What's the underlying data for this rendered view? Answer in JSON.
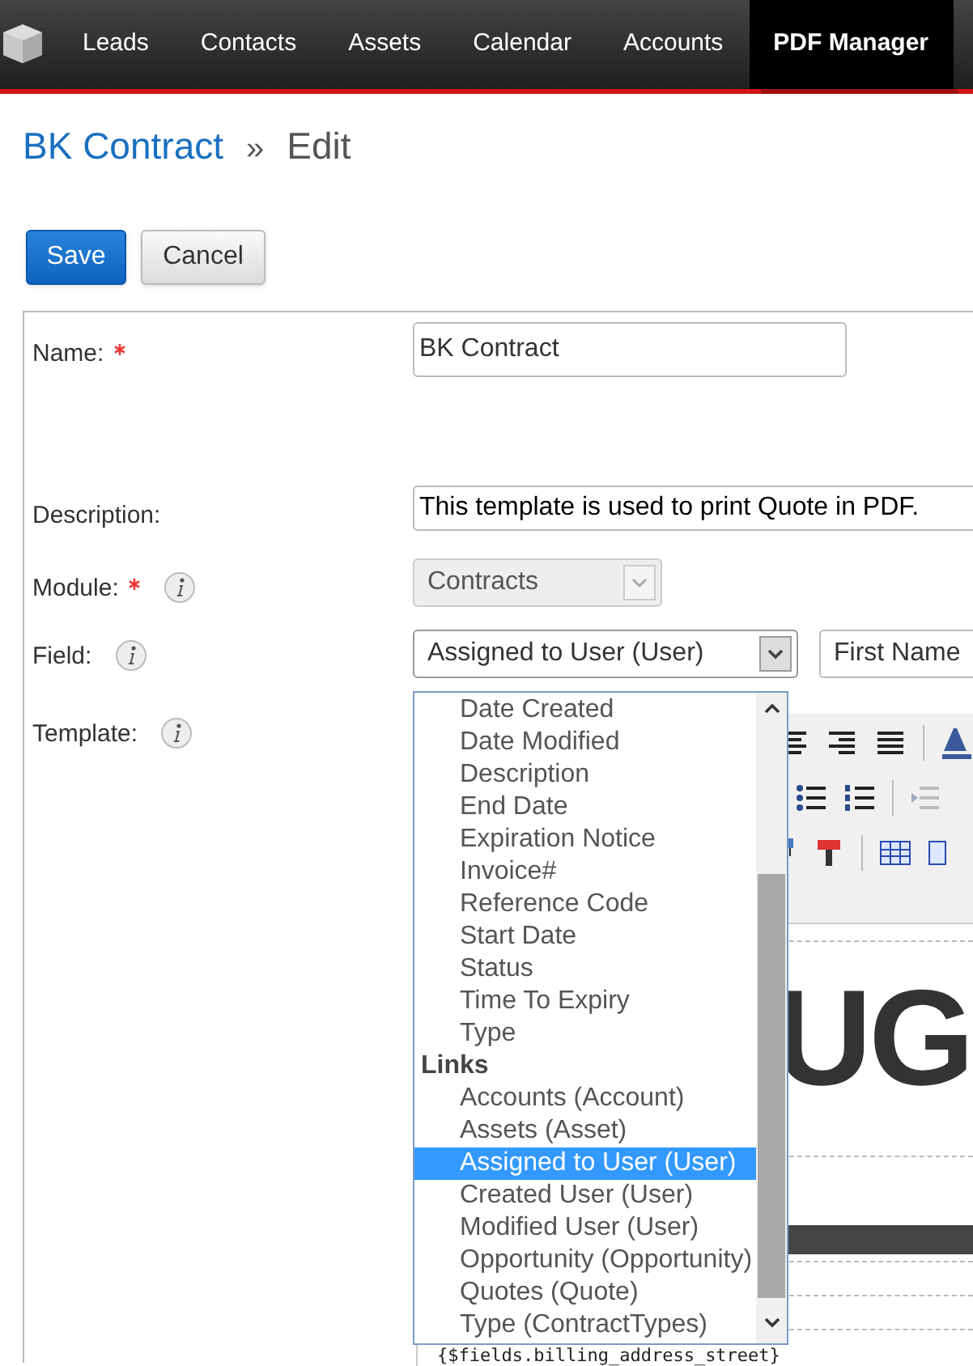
{
  "nav": {
    "items": [
      {
        "label": "Leads",
        "selected": false
      },
      {
        "label": "Contacts",
        "selected": false
      },
      {
        "label": "Assets",
        "selected": false
      },
      {
        "label": "Calendar",
        "selected": false
      },
      {
        "label": "Accounts",
        "selected": false
      },
      {
        "label": "PDF Manager",
        "selected": true
      }
    ]
  },
  "breadcrumb": {
    "record": "BK Contract",
    "separator": "»",
    "action": "Edit"
  },
  "buttons": [
    {
      "label": "Save",
      "kind": "primary"
    },
    {
      "label": "Cancel",
      "kind": "secondary"
    }
  ],
  "form": {
    "name": {
      "label": "Name:",
      "required": true,
      "value": "BK Contract"
    },
    "description": {
      "label": "Description:",
      "value": "This template is used to print Quote in PDF."
    },
    "module": {
      "label": "Module:",
      "required": true,
      "value": "Contracts",
      "disabled": true
    },
    "field": {
      "label": "Field:",
      "value": "Assigned to User (User)",
      "subfield": "First Name"
    },
    "template": {
      "label": "Template:",
      "logo_text": "UG",
      "snippet": "{$fields.billing_address_street}"
    }
  },
  "dropdown": {
    "groups": [
      {
        "options": [
          {
            "label": "Date Created",
            "selected": false
          },
          {
            "label": "Date Modified",
            "selected": false
          },
          {
            "label": "Description",
            "selected": false
          },
          {
            "label": "End Date",
            "selected": false
          },
          {
            "label": "Expiration Notice",
            "selected": false
          },
          {
            "label": "Invoice#",
            "selected": false
          },
          {
            "label": "Reference Code",
            "selected": false
          },
          {
            "label": "Start Date",
            "selected": false
          },
          {
            "label": "Status",
            "selected": false
          },
          {
            "label": "Time To Expiry",
            "selected": false
          },
          {
            "label": "Type",
            "selected": false
          }
        ]
      },
      {
        "label": "Links",
        "options": [
          {
            "label": "Accounts (Account)",
            "selected": false
          },
          {
            "label": "Assets (Asset)",
            "selected": false
          },
          {
            "label": "Assigned to User (User)",
            "selected": true
          },
          {
            "label": "Created User (User)",
            "selected": false
          },
          {
            "label": "Modified User (User)",
            "selected": false
          },
          {
            "label": "Opportunity (Opportunity)",
            "selected": false
          },
          {
            "label": "Quotes (Quote)",
            "selected": false
          },
          {
            "label": "Type (ContractTypes)",
            "selected": false
          }
        ]
      }
    ]
  }
}
